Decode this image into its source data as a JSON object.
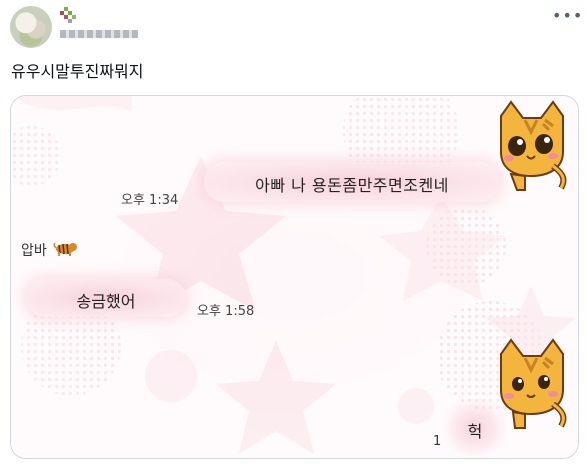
{
  "post": {
    "more_icon": "ellipsis-icon",
    "text": "유우시말투진짜뭐지"
  },
  "media": {
    "messages": [
      {
        "id": "m1",
        "text": "아빠 나 용돈좀만주면조켄네",
        "time": "오후 1:34"
      },
      {
        "id": "m2",
        "sender": "압바",
        "sender_icon": "tiger-emoji-icon",
        "text": "송금했어",
        "time": "오후 1:58"
      },
      {
        "id": "m3",
        "text": "헉",
        "unread_count": "1"
      }
    ]
  },
  "colors": {
    "bubble": "#f8d2dc",
    "background": "#fff7f9",
    "star": "#f6c9d4",
    "cat_fur": "#f3b53d",
    "cat_stripe": "#c98223"
  }
}
